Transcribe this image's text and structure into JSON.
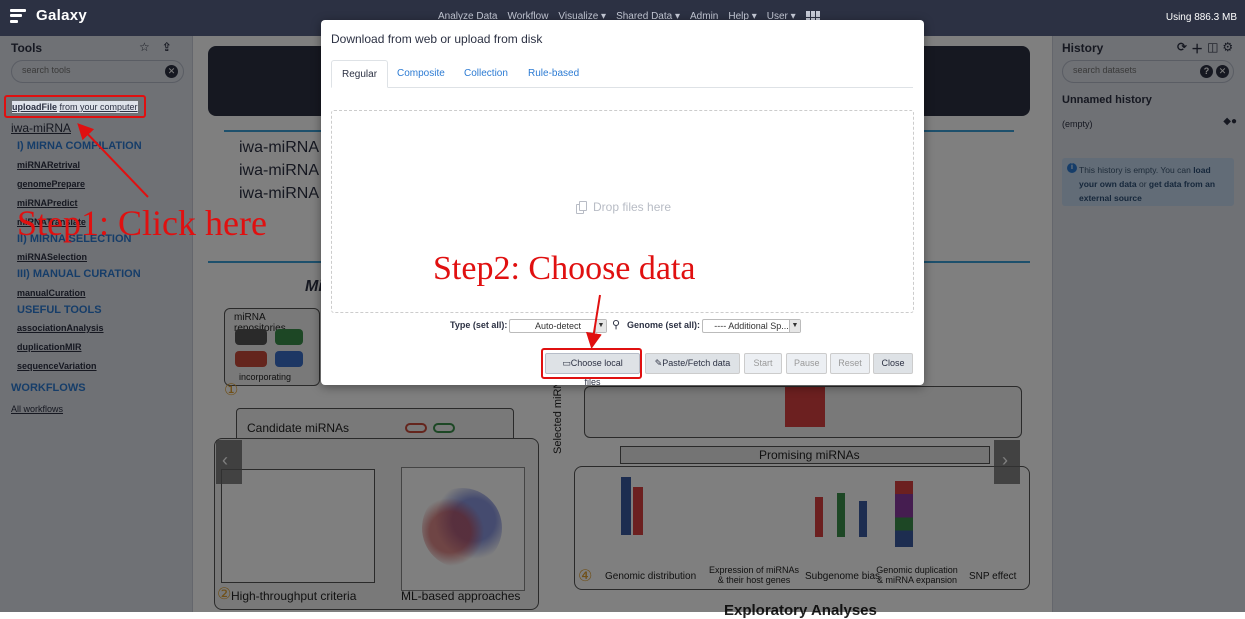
{
  "masthead": {
    "brand": "Galaxy",
    "nav": [
      "Analyze Data",
      "Workflow",
      "Visualize ▾",
      "Shared Data ▾",
      "Admin",
      "Help ▾",
      "User ▾"
    ],
    "usage": "Using 886.3 MB"
  },
  "tools": {
    "title": "Tools",
    "search_placeholder": "search tools",
    "upload_bold": "uploadFile",
    "upload_rest": "from your computer",
    "group": "iwa-miRNA",
    "sections": [
      {
        "title": "I) MIRNA COMPILATION",
        "items": [
          "miRNARetrival",
          "genomePrepare",
          "miRNAPredict",
          "miRNATranslate"
        ]
      },
      {
        "title": "II) MIRNA SELECTION",
        "items": [
          "miRNASelection"
        ]
      },
      {
        "title": "III) MANUAL CURATION",
        "items": [
          "manualCuration"
        ]
      },
      {
        "title": "USEFUL TOOLS",
        "items": [
          "associationAnalysis",
          "duplicationMIR",
          "sequenceVariation"
        ]
      }
    ],
    "workflows_title": "WORKFLOWS",
    "all_workflows": "All workflows"
  },
  "history": {
    "title": "History",
    "search_placeholder": "search datasets",
    "name": "Unnamed history",
    "empty": "(empty)",
    "info_pre": "This history is empty. You can ",
    "info_link1": "load your own data",
    "info_mid": " or ",
    "info_link2": "get data from an external source"
  },
  "center": {
    "bullets": [
      "iwa-miRNA",
      "iwa-miRNA",
      "iwa-miRNA"
    ],
    "figure_title": "Mi",
    "labels": {
      "repos": "miRNA repositories",
      "incorporating": "incorporating",
      "candidate": "Candidate miRNAs",
      "promising": "Promising miRNAs",
      "selected": "Selected miRNAs",
      "hts": "High-throughput criteria",
      "ml": "ML-based approaches",
      "genomic": "Genomic distribution",
      "expression": "Expression of miRNAs & their host genes",
      "subgenome": "Subgenome bias",
      "duplication": "Genomic duplication & miRNA expansion",
      "snp": "SNP effect",
      "exploratory": "Exploratory Analyses"
    }
  },
  "modal": {
    "title": "Download from web or upload from disk",
    "tabs": [
      "Regular",
      "Composite",
      "Collection",
      "Rule-based"
    ],
    "drop_text": "Drop files here",
    "type_label": "Type (set all):",
    "type_value": "Auto-detect",
    "genome_label": "Genome (set all):",
    "genome_value": "---- Additional Sp...",
    "buttons": {
      "choose": "Choose local files",
      "paste": "Paste/Fetch data",
      "start": "Start",
      "pause": "Pause",
      "reset": "Reset",
      "close": "Close"
    }
  },
  "annotations": {
    "step1": "Step1: Click here",
    "step2": "Step2: Choose data"
  }
}
